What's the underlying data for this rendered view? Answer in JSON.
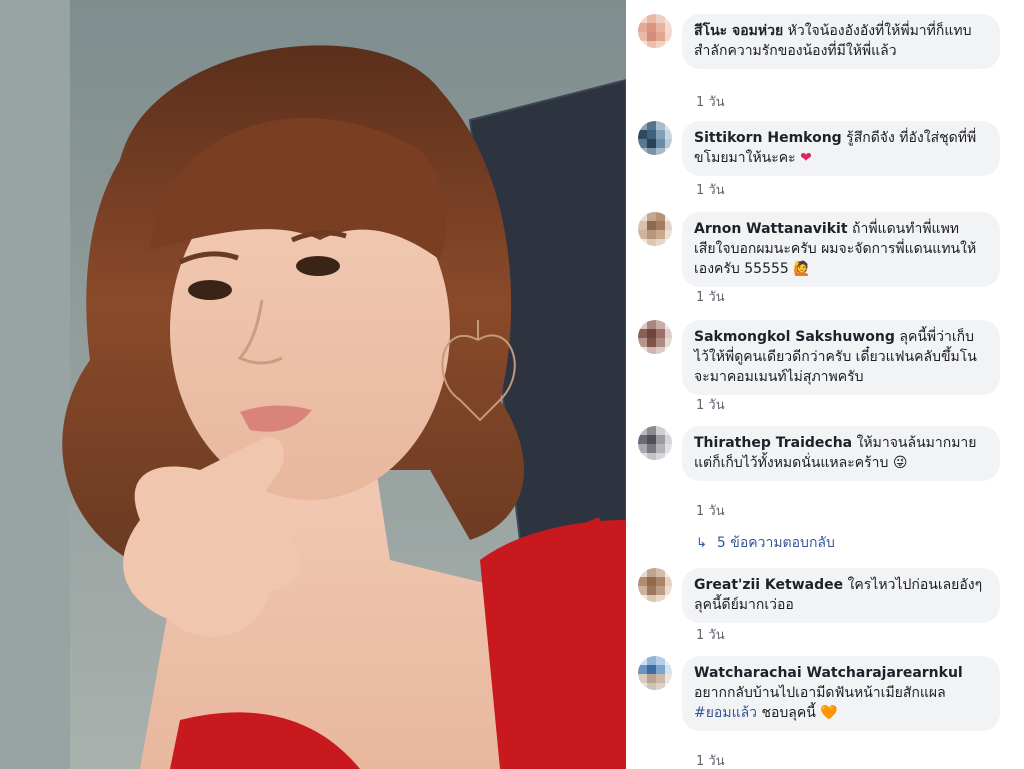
{
  "comments": [
    {
      "author": "สีโนะ จอมห่วย",
      "text": "หัวใจน้องอังอังที่ให้พี่มาที่ก็แทบสำลักความรักของน้องที่มีให้พี่แล้ว",
      "emoji": "",
      "time": "1 วัน"
    },
    {
      "author": "Sittikorn Hemkong",
      "text": "รู้สึกดีจัง ที่อังใส่ชุดที่พี่ขโมยมาให้นะคะ",
      "emoji": "❤",
      "time": "1 วัน"
    },
    {
      "author": "Arnon Wattanavikit",
      "text": "ถ้าพี่แดนทำพี่แพทเสียใจบอกผมนะครับ ผมจะจัดการพี่แดนแทนให้เองครับ 55555",
      "emoji": "🙋",
      "time": "1 วัน"
    },
    {
      "author": "Sakmongkol Sakshuwong",
      "text": "ลุคนี้พี่ว่าเก็บไว้ให้พี่ดูคนเดียวดีกว่าครับ เดี๋ยวแฟนคลับขึ้มโนจะมาคอมเมนท์ไม่สุภาพครับ",
      "emoji": "",
      "time": "1 วัน"
    },
    {
      "author": "Thirathep Traidecha",
      "text": "ให้มาจนล้นมากมาย แต่ก็เก็บไว้ทั้งหมดนั่นแหละคร้าบ",
      "emoji": "😜",
      "time": "1 วัน"
    },
    {
      "author": "Great'zii Ketwadee",
      "text": "ใครไหวไปก่อนเลยอังๆ ลุคนี้ดีย์มากเว่ออ",
      "emoji": "",
      "time": "1 วัน"
    },
    {
      "author": "Watcharachai Watcharajarearnkul",
      "text": "อยากกลับบ้านไปเอามีดฟันหน้าเมียสักแผล",
      "hashtag": "#ยอมแล้ว",
      "text2": "ชอบลุคนี้",
      "emoji": "🧡",
      "time": "1 วัน"
    }
  ],
  "replies_label": "5 ข้อความตอบกลับ",
  "colors": {
    "bubble": "#f2f3f5",
    "link": "#385898",
    "time": "#606770",
    "dress": "#c8191f"
  }
}
